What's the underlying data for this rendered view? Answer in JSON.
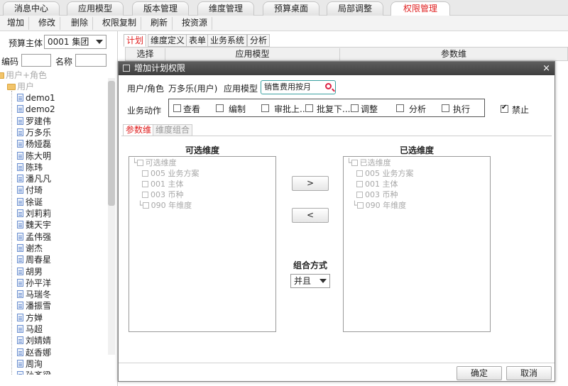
{
  "top_tabs": [
    "消息中心",
    "应用模型",
    "版本管理",
    "维度管理",
    "预算桌面",
    "局部调整",
    "权限管理"
  ],
  "toolbar": [
    "增加",
    "修改",
    "删除",
    "权限复制",
    "刷新",
    "按资源"
  ],
  "left": {
    "budget_label": "预算主体",
    "budget_value": "0001 集团",
    "code_label": "编码",
    "name_label": "名称",
    "root": "用户+角色",
    "users_folder": "用户",
    "users": [
      "demo1",
      "demo2",
      "罗建伟",
      "万多乐",
      "杨娅磊",
      "陈大明",
      "陈玮",
      "潘凡凡",
      "付琦",
      "徐诞",
      "刘莉莉",
      "魏天宇",
      "孟伟强",
      "谢杰",
      "周春星",
      "胡男",
      "孙平洋",
      "马瑞冬",
      "潘振雪",
      "方婵",
      "马超",
      "刘婧婧",
      "赵香娜",
      "周洵",
      "孙齐梁"
    ]
  },
  "inner_tabs": [
    "计划",
    "维度定义",
    "表单",
    "业务系统",
    "分析"
  ],
  "grid_headers": [
    "选择",
    "应用模型",
    "参数维"
  ],
  "dialog": {
    "title": "增加计划权限",
    "close": "×",
    "user_role_label": "用户/角色",
    "user_role_value": "万多乐(用户)",
    "model_label": "应用模型",
    "model_value": "销售费用按月",
    "actions_label": "业务动作",
    "actions": [
      "查看",
      "编制",
      "审批上...",
      "批复下...",
      "调整",
      "分析",
      "执行"
    ],
    "ban_label": "禁止",
    "sub_tabs": [
      "参数维",
      "维度组合"
    ],
    "available_title": "可选维度",
    "selected_title": "已选维度",
    "available_root": "可选维度",
    "selected_root": "已选维度",
    "dims": [
      "005 业务方案",
      "001 主体",
      "003 币种",
      "090 年维度"
    ],
    "move_right": ">",
    "move_left": "<",
    "combine_label": "组合方式",
    "combine_value": "并且",
    "ok": "确定",
    "cancel": "取消"
  }
}
